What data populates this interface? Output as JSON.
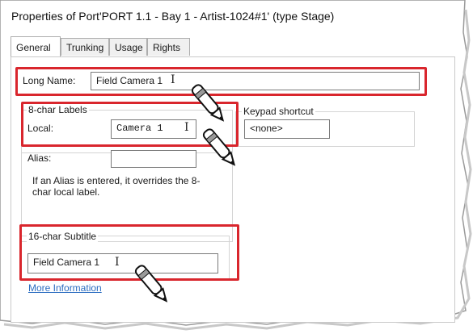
{
  "window": {
    "title": "Properties of Port'PORT 1.1 - Bay 1 - Artist-1024#1' (type Stage)"
  },
  "tabs": [
    {
      "label": "General",
      "active": true
    },
    {
      "label": "Trunking",
      "active": false
    },
    {
      "label": "Usage",
      "active": false
    },
    {
      "label": "Rights",
      "active": false
    }
  ],
  "general": {
    "long_name_label": "Long Name:",
    "long_name_value": "Field Camera 1",
    "labels_group": "8-char Labels",
    "local_label": "Local:",
    "local_value": "Camera 1",
    "alias_label": "Alias:",
    "alias_value": "",
    "alias_help": "If an Alias is entered, it overrides the 8-char local label.",
    "keypad_group": "Keypad shortcut",
    "keypad_value": "<none>",
    "subtitle_group": "16-char Subtitle",
    "subtitle_value": "Field Camera 1",
    "more_info_link": "More Information"
  },
  "colors": {
    "highlight": "#d9262d",
    "link": "#2a6cc0"
  },
  "icons": {
    "cursor": "text-cursor-icon",
    "pointer": "pen-pointer-icon"
  }
}
